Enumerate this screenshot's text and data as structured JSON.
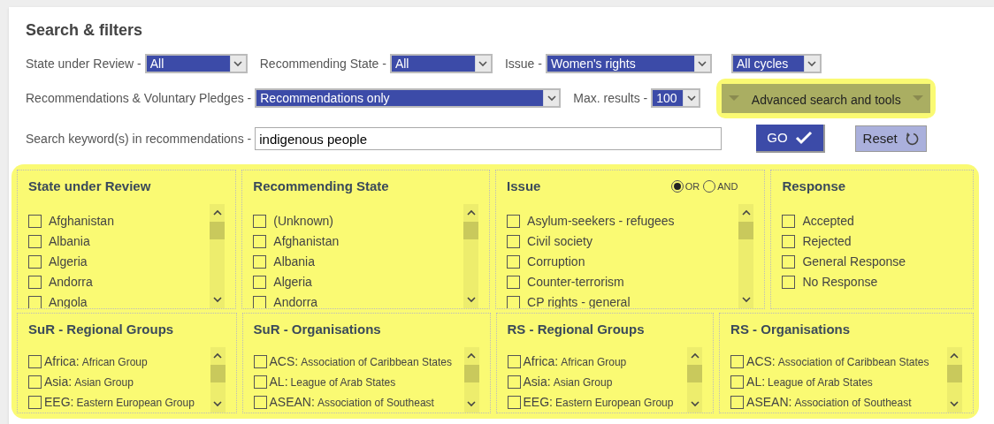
{
  "title": "Search & filters",
  "filter_rows": [
    [
      {
        "kind": "select",
        "label": "State under Review -",
        "value": "All"
      },
      {
        "kind": "select",
        "label": "Recommending State -",
        "value": "All"
      },
      {
        "kind": "select",
        "label": "Issue -",
        "value": "Women's rights"
      },
      {
        "kind": "select",
        "value": "All cycles"
      }
    ],
    [
      {
        "kind": "select",
        "label": "Recommendations & Voluntary Pledges -",
        "value": "Recommendations only"
      },
      {
        "kind": "select",
        "label": "Max. results -",
        "value": "100"
      },
      {
        "kind": "toggle",
        "value": "Advanced search and tools",
        "highlighted": true
      }
    ],
    [
      {
        "kind": "input",
        "label": "Search keyword(s) in recommendations -",
        "value": "indigenous people"
      },
      {
        "kind": "go",
        "value": "GO"
      },
      {
        "kind": "reset",
        "value": "Reset"
      }
    ]
  ],
  "panels_highlighted": true,
  "panel_rows": [
    [
      {
        "title": "State under Review",
        "kind": "plain",
        "scroll": true,
        "items": [
          {
            "label": "Afghanistan",
            "checked": false
          },
          {
            "label": "Albania",
            "checked": false
          },
          {
            "label": "Algeria",
            "checked": false
          },
          {
            "label": "Andorra",
            "checked": false
          },
          {
            "label": "Angola",
            "checked": false
          }
        ]
      },
      {
        "title": "Recommending State",
        "kind": "plain",
        "scroll": true,
        "items": [
          {
            "label": "(Unknown)",
            "checked": false
          },
          {
            "label": "Afghanistan",
            "checked": false
          },
          {
            "label": "Albania",
            "checked": false
          },
          {
            "label": "Algeria",
            "checked": false
          },
          {
            "label": "Andorra",
            "checked": false
          }
        ]
      },
      {
        "title": "Issue",
        "kind": "plain",
        "scroll": true,
        "logic": [
          {
            "label": "OR",
            "selected": true
          },
          {
            "label": "AND",
            "selected": false
          }
        ],
        "items": [
          {
            "label": "Asylum-seekers - refugees",
            "checked": false
          },
          {
            "label": "Civil society",
            "checked": false
          },
          {
            "label": "Corruption",
            "checked": false
          },
          {
            "label": "Counter-terrorism",
            "checked": false
          },
          {
            "label": "CP rights - general",
            "checked": false
          }
        ]
      },
      {
        "title": "Response",
        "kind": "plain",
        "scroll": false,
        "items": [
          {
            "label": "Accepted",
            "checked": false
          },
          {
            "label": "Rejected",
            "checked": false
          },
          {
            "label": "General Response",
            "checked": false
          },
          {
            "label": "No Response",
            "checked": false
          }
        ]
      }
    ],
    [
      {
        "title": "SuR - Regional Groups",
        "kind": "group",
        "scroll": true,
        "items": [
          {
            "code": "Africa:",
            "label": "African Group",
            "checked": false
          },
          {
            "code": "Asia:",
            "label": "Asian Group",
            "checked": false
          },
          {
            "code": "EEG:",
            "label": "Eastern European Group",
            "checked": false
          }
        ]
      },
      {
        "title": "SuR - Organisations",
        "kind": "group",
        "scroll": true,
        "items": [
          {
            "code": "ACS:",
            "label": "Association of Caribbean States",
            "checked": false
          },
          {
            "code": "AL:",
            "label": "League of Arab States",
            "checked": false
          },
          {
            "code": "ASEAN:",
            "label": "Association of Southeast",
            "checked": false
          }
        ]
      },
      {
        "title": "RS - Regional Groups",
        "kind": "group",
        "scroll": true,
        "items": [
          {
            "code": "Africa:",
            "label": "African Group",
            "checked": false
          },
          {
            "code": "Asia:",
            "label": "Asian Group",
            "checked": false
          },
          {
            "code": "EEG:",
            "label": "Eastern European Group",
            "checked": false
          }
        ]
      },
      {
        "title": "RS - Organisations",
        "kind": "group",
        "scroll": true,
        "items": [
          {
            "code": "ACS:",
            "label": "Association of Caribbean States",
            "checked": false
          },
          {
            "code": "AL:",
            "label": "League of Arab States",
            "checked": false
          },
          {
            "code": "ASEAN:",
            "label": "Association of Southeast",
            "checked": false
          }
        ]
      }
    ]
  ]
}
